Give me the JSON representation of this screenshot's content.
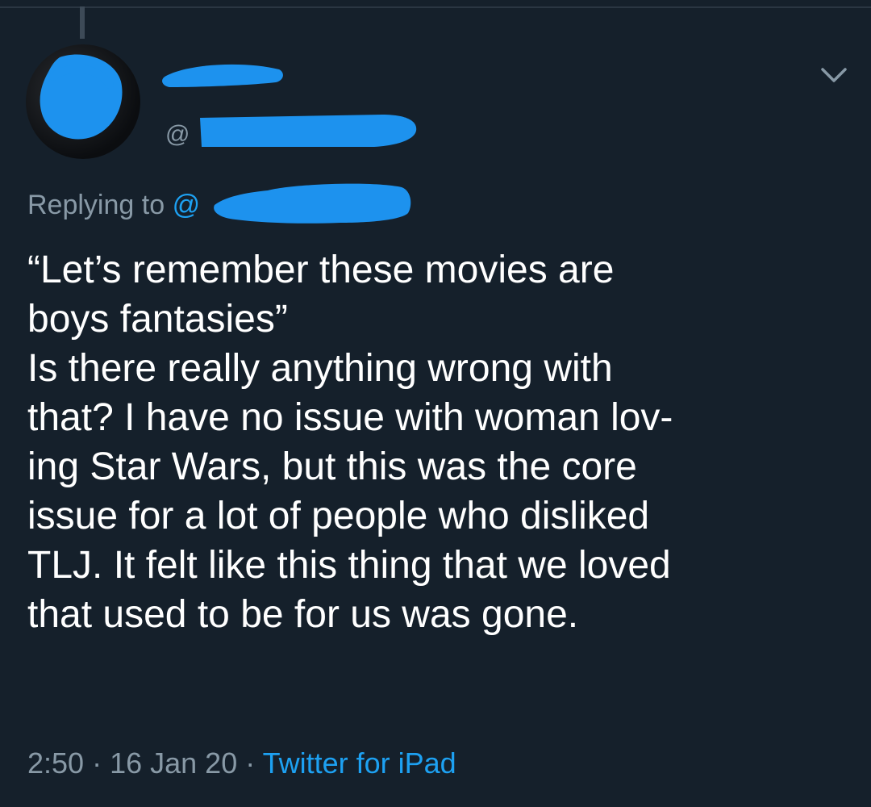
{
  "tweet": {
    "handle_prefix": "@",
    "reply_prefix": "Replying to",
    "reply_mention_prefix": "@",
    "text_lines": [
      "“Let’s remember these movies are",
      "boys fantasies”",
      "Is there really anything wrong with",
      "that? I have no issue with woman lov-",
      "ing Star Wars, but this was the core",
      "issue for a lot of people who disliked",
      "TLJ. It felt like this thing that we loved",
      "that used to be for us was gone."
    ],
    "time": "2:50",
    "separator": " · ",
    "date": "16 Jan 20",
    "source": "Twitter for iPad"
  },
  "icons": {
    "more": "chevron-down-icon"
  },
  "colors": {
    "background": "#15202b",
    "text_primary": "#ffffff",
    "text_secondary": "#8899a6",
    "accent": "#1da1f2",
    "redaction": "#1d92ee"
  }
}
